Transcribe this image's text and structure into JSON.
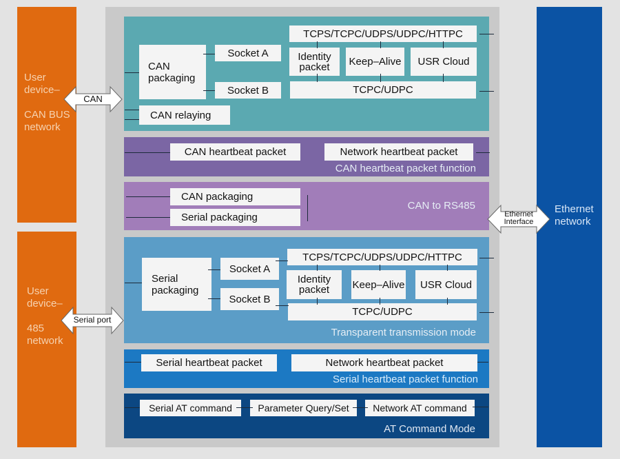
{
  "left_devices": [
    {
      "line1": "User",
      "line2": "device–",
      "line3": "CAN BUS",
      "line4": "network",
      "connector": "CAN"
    },
    {
      "line1": "User",
      "line2": "device–",
      "line3": "485",
      "line4": "network",
      "connector": "Serial port"
    }
  ],
  "right_device": {
    "line1": "Ethernet",
    "line2": "network",
    "connector_line1": "Ethernet",
    "connector_line2": "Interface"
  },
  "can_section": {
    "packaging_line1": "CAN",
    "packaging_line2": "packaging",
    "socket_a": "Socket A",
    "socket_b": "Socket B",
    "relaying": "CAN relaying",
    "protocols": "TCPS/TCPC/UDPS/UDPC/HTTPC",
    "identity_line1": "Identity",
    "identity_line2": "packet",
    "keep_alive": "Keep–Alive",
    "usr_cloud": "USR Cloud",
    "tcpc_udpc": "TCPC/UDPC"
  },
  "can_heartbeat": {
    "can_packet": "CAN heartbeat packet",
    "network_packet": "Network heartbeat packet",
    "caption": "CAN heartbeat packet function"
  },
  "can_rs485": {
    "can_packaging": "CAN packaging",
    "serial_packaging": "Serial packaging",
    "caption": "CAN to RS485"
  },
  "transparent": {
    "packaging_line1": "Serial",
    "packaging_line2": "packaging",
    "socket_a": "Socket A",
    "socket_b": "Socket B",
    "protocols": "TCPS/TCPC/UDPS/UDPC/HTTPC",
    "identity_line1": "Identity",
    "identity_line2": "packet",
    "keep_alive": "Keep–Alive",
    "usr_cloud": "USR Cloud",
    "tcpc_udpc": "TCPC/UDPC",
    "caption": "Transparent transmission mode"
  },
  "serial_heartbeat": {
    "serial_packet": "Serial heartbeat packet",
    "network_packet": "Network heartbeat packet",
    "caption": "Serial heartbeat packet function"
  },
  "at_mode": {
    "serial_at": "Serial AT command",
    "param": "Parameter Query/Set",
    "network_at": "Network AT command",
    "caption": "AT Command Mode"
  },
  "colors": {
    "orange": "#e06a10",
    "ethernet_blue": "#0b53a4",
    "teal": "#5ba9b1",
    "purple_dark": "#7b66a4",
    "purple_light": "#a17db9",
    "blue_mid": "#5b9dc7",
    "blue_bright": "#1c79c3",
    "navy": "#0c4782"
  }
}
